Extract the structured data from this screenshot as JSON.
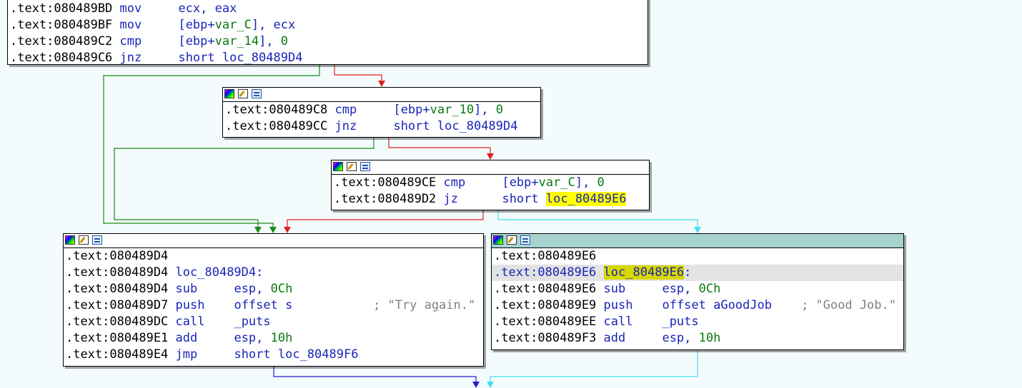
{
  "colors": {
    "background": "#f4fbfd",
    "edge_false": "#1a8a1a",
    "edge_true": "#e02020",
    "edge_jz_taken": "#40e0f0",
    "edge_jmp": "#2020d0",
    "selected_header": "#a7d3cf",
    "highlight": "#ffff00"
  },
  "header_icons": [
    "color-icon",
    "edit-icon",
    "graph-icon"
  ],
  "blocks": {
    "top": {
      "lines": [
        {
          "addr": ".text:080489BD",
          "mn": "mov",
          "op1": "ecx, eax"
        },
        {
          "addr": ".text:080489BF",
          "mn": "mov",
          "op_pre": "[ebp+",
          "op_var": "var_C",
          "op_post": "], ecx"
        },
        {
          "addr": ".text:080489C2",
          "mn": "cmp",
          "op_pre": "[ebp+",
          "op_var": "var_14",
          "op_post": "], ",
          "op_num": "0"
        },
        {
          "addr": ".text:080489C6",
          "mn": "jnz",
          "op1": "short loc_80489D4"
        }
      ]
    },
    "b2": {
      "lines": [
        {
          "addr": ".text:080489C8",
          "mn": "cmp",
          "op_pre": "[ebp+",
          "op_var": "var_10",
          "op_post": "], ",
          "op_num": "0"
        },
        {
          "addr": ".text:080489CC",
          "mn": "jnz",
          "op1": "short loc_80489D4"
        }
      ]
    },
    "b3": {
      "lines": [
        {
          "addr": ".text:080489CE",
          "mn": "cmp",
          "op_pre": "[ebp+",
          "op_var": "var_C",
          "op_post": "], ",
          "op_num": "0"
        },
        {
          "addr": ".text:080489D2",
          "mn": "jz",
          "op_pre": "short ",
          "op_lbl": "loc_80489E6"
        }
      ]
    },
    "left": {
      "lines": [
        {
          "addr": ".text:080489D4"
        },
        {
          "addr": ".text:080489D4",
          "label": "loc_80489D4:"
        },
        {
          "addr": ".text:080489D4",
          "mn": "sub",
          "op_pre": "esp, ",
          "op_num": "0Ch"
        },
        {
          "addr": ".text:080489D7",
          "mn": "push",
          "op1": "offset s",
          "comment": "; \"Try again.\""
        },
        {
          "addr": ".text:080489DC",
          "mn": "call",
          "op1": "_puts"
        },
        {
          "addr": ".text:080489E1",
          "mn": "add",
          "op_pre": "esp, ",
          "op_num": "10h"
        },
        {
          "addr": ".text:080489E4",
          "mn": "jmp",
          "op1": "short loc_80489F6"
        }
      ]
    },
    "right": {
      "lines": [
        {
          "addr": ".text:080489E6"
        },
        {
          "addr": ".text:080489E6",
          "label": "loc_80489E6",
          "label_suffix": ":"
        },
        {
          "addr": ".text:080489E6",
          "mn": "sub",
          "op_pre": "esp, ",
          "op_num": "0Ch"
        },
        {
          "addr": ".text:080489E9",
          "mn": "push",
          "op1": "offset aGoodJob",
          "comment": "; \"Good Job.\""
        },
        {
          "addr": ".text:080489EE",
          "mn": "call",
          "op1": "_puts"
        },
        {
          "addr": ".text:080489F3",
          "mn": "add",
          "op_pre": "esp, ",
          "op_num": "10h"
        }
      ]
    }
  }
}
